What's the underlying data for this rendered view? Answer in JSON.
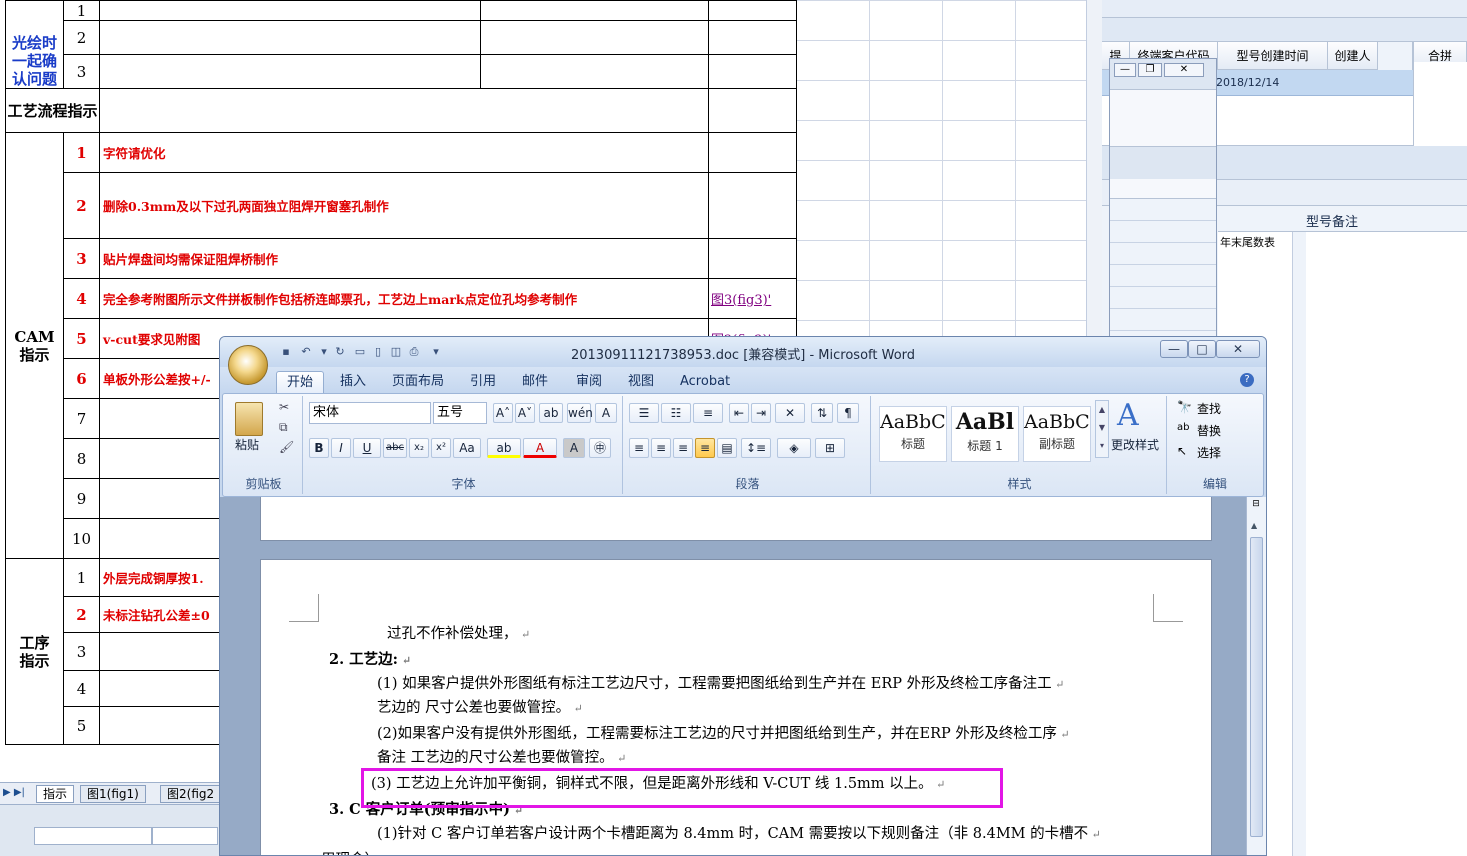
{
  "excel": {
    "side_partial": "光绘时\n一起确\n认问题",
    "rows_top": [
      "1",
      "2",
      "3"
    ],
    "section_process": "工艺流程指示",
    "section_cam": "CAM\n指示",
    "section_proc": "工序\n指示",
    "cam_rows": [
      {
        "n": "1",
        "text": "字符请优化",
        "red": true
      },
      {
        "n": "2",
        "text": "删除0.3mm及以下过孔两面独立阻焊开窗塞孔制作",
        "red": true
      },
      {
        "n": "3",
        "text": "贴片焊盘间均需保证阻焊桥制作",
        "red": true
      },
      {
        "n": "4",
        "text": "完全参考附图所示文件拼板制作包括桥连邮票孔，工艺边上mark点定位孔均参考制作",
        "red": true,
        "link": "图3(fig3)'"
      },
      {
        "n": "5",
        "text": "v-cut要求见附图",
        "red": true,
        "link": "图2(fig2)'"
      },
      {
        "n": "6",
        "text": "单板外形公差按+/-",
        "red": true
      },
      {
        "n": "7",
        "text": "",
        "red": false
      },
      {
        "n": "8",
        "text": "",
        "red": false
      },
      {
        "n": "9",
        "text": "",
        "red": false
      },
      {
        "n": "10",
        "text": "",
        "red": false
      }
    ],
    "proc_rows": [
      {
        "n": "1",
        "text": "外层完成铜厚按1.",
        "red": false
      },
      {
        "n": "2",
        "text": "未标注钻孔公差±0",
        "red": true
      },
      {
        "n": "3",
        "text": "",
        "red": false
      },
      {
        "n": "4",
        "text": "",
        "red": false
      },
      {
        "n": "5",
        "text": "",
        "red": false
      }
    ],
    "sheet_tabs": [
      "指示",
      "图1(fig1)",
      "图2(fig2"
    ]
  },
  "rightapp": {
    "headers": [
      "提",
      "终端客户代码",
      "型号创建时间",
      "创建人",
      "合拼"
    ],
    "row_date": "2018/12/14",
    "col_remark": "型号备注",
    "col_tail": "年末尾数表"
  },
  "word": {
    "title": "20130911121738953.doc [兼容模式] - Microsoft Word",
    "tabs": [
      "开始",
      "插入",
      "页面布局",
      "引用",
      "邮件",
      "审阅",
      "视图",
      "Acrobat"
    ],
    "groups": {
      "clipboard": "剪贴板",
      "paste": "粘贴",
      "font": "字体",
      "paragraph": "段落",
      "styles": "样式",
      "editing": "编辑"
    },
    "font_name": "宋体",
    "font_size": "五号",
    "styles": [
      {
        "preview": "AaBbC(",
        "label": "标题"
      },
      {
        "preview": "AaBl",
        "label": "标题 1"
      },
      {
        "preview": "AaBbC(",
        "label": "副标题"
      }
    ],
    "change_styles": "更改样式",
    "find": "查找",
    "replace": "替换",
    "select": "选择",
    "doc_lines": [
      "过孔不作补偿处理，",
      "2. 工艺边:",
      "(1) 如果客户提供外形图纸有标注工艺边尺寸，工程需要把图纸给到生产并在 ERP 外形及终检工序备注工",
      "艺边的 尺寸公差也要做管控。",
      "(2)如果客户没有提供外形图纸，工程需要标注工艺边的尺寸并把图纸给到生产，并在ERP 外形及终检工序",
      "备注  工艺边的尺寸公差也要做管控。",
      "(3) 工艺边上允许加平衡铜，铜样式不限，但是距离外形线和 V-CUT 线 1.5mm 以上。",
      "3. C 客户订单(预审指示中)",
      "(1)针对 C 客户订单若客户设计两个卡槽距离为 8.4mm 时，CAM 需要按以下规则备注（非 8.4MM 的卡槽不",
      "用理会）"
    ]
  },
  "colors": {
    "highlight": "#e216e6",
    "red_text": "#e00000",
    "link": "#800080"
  }
}
